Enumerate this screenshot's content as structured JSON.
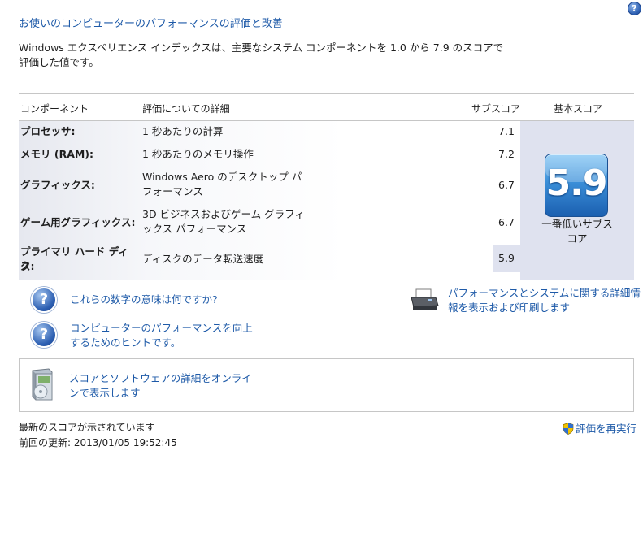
{
  "page": {
    "title": "お使いのコンピューターのパフォーマンスの評価と改善",
    "intro_line1": "Windows エクスペリエンス インデックスは、主要なシステム コンポーネントを 1.0 から 7.9 のスコアで",
    "intro_line2": "評価した値です。",
    "help_glyph": "?"
  },
  "table": {
    "headers": {
      "component": "コンポーネント",
      "details": "評価についての詳細",
      "subscore": "サブスコア",
      "basescore": "基本スコア"
    },
    "rows": [
      {
        "component": "プロセッサ:",
        "details": "1 秒あたりの計算",
        "details2": "",
        "subscore": "7.1"
      },
      {
        "component": "メモリ (RAM):",
        "details": "1 秒あたりのメモリ操作",
        "details2": "",
        "subscore": "7.2"
      },
      {
        "component": "グラフィックス:",
        "details": "Windows Aero のデスクトップ パ",
        "details2": "フォーマンス",
        "subscore": "6.7"
      },
      {
        "component": "ゲーム用グラフィックス:",
        "details": "3D ビジネスおよびゲーム グラフィ",
        "details2": "ックス パフォーマンス",
        "subscore": "6.7"
      },
      {
        "component": "プライマリ ハード ディス",
        "component2": "ク:",
        "details": "ディスクのデータ転送速度",
        "details2": "",
        "subscore": "5.9"
      }
    ],
    "base_score": "5.9",
    "base_caption_line1": "一番低いサブス",
    "base_caption_line2": "コア"
  },
  "links": {
    "meaning": "これらの数字の意味は何ですか?",
    "tips_line1": "コンピューターのパフォーマンスを向上",
    "tips_line2": "するためのヒントです。",
    "print_line1": "パフォーマンスとシステムに関する詳細情",
    "print_line2": "報を表示および印刷します",
    "online_line1": "スコアとソフトウェアの詳細をオンライ",
    "online_line2": "ンで表示します"
  },
  "status": {
    "line1": "最新のスコアが示されています",
    "line2": "前回の更新: 2013/01/05 19:52:45",
    "rerun": "評価を再実行"
  },
  "icons": {
    "help": "help-icon",
    "question": "question-icon",
    "printer": "printer-icon",
    "online": "software-box-icon",
    "shield": "uac-shield-icon"
  },
  "colors": {
    "link": "#1e5aa8",
    "base_panel": "#dfe2ef",
    "badge": "#3b8fd8"
  }
}
